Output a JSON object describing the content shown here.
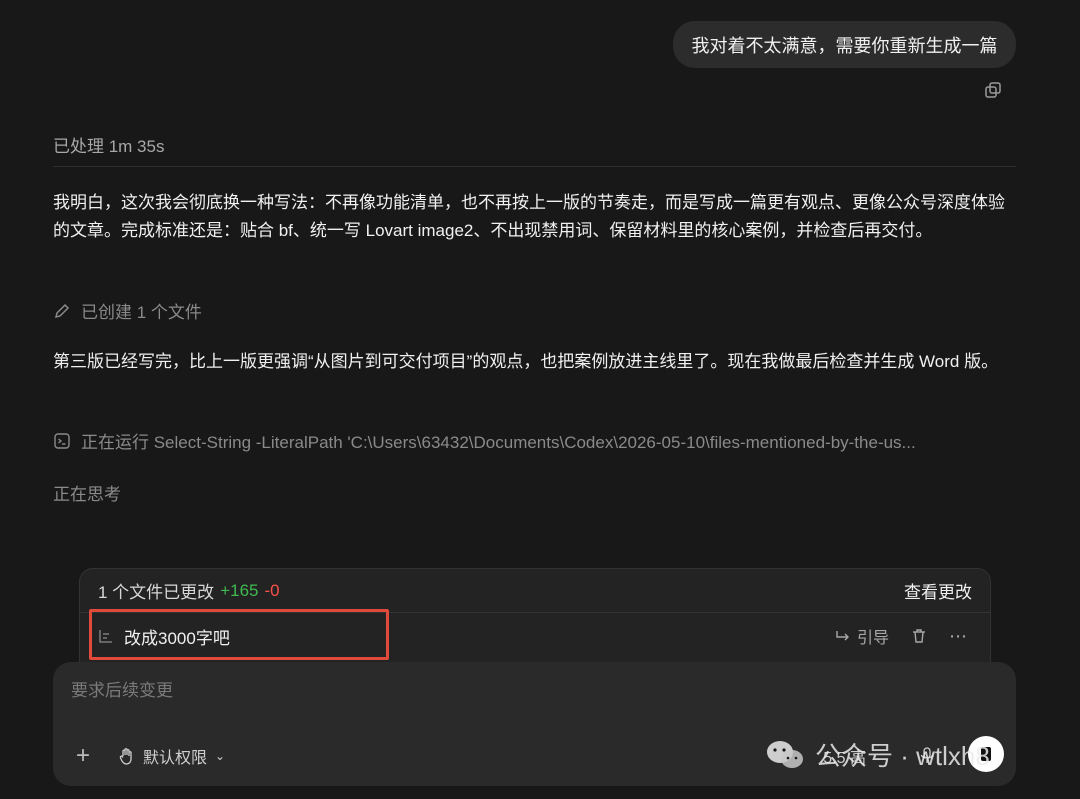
{
  "conversation": {
    "user_message": "我对着不太满意，需要你重新生成一篇",
    "processed_label": "已处理 1m 35s",
    "assistant_para1": "我明白，这次我会彻底换一种写法：不再像功能清单，也不再按上一版的节奏走，而是写成一篇更有观点、更像公众号深度体验的文章。完成标准还是：贴合 bf、统一写 Lovart image2、不出现禁用词、保留材料里的核心案例，并检查后再交付。",
    "created_files_label": "已创建 1 个文件",
    "assistant_para2": "第三版已经写完，比上一版更强调“从图片到可交付项目”的观点，也把案例放进主线里了。现在我做最后检查并生成 Word 版。",
    "running_command": "正在运行 Select-String -LiteralPath 'C:\\Users\\63432\\Documents\\Codex\\2026-05-10\\files-mentioned-by-the-us...",
    "thinking_label": "正在思考"
  },
  "changes_panel": {
    "title": "1 个文件已更改",
    "additions": "+165",
    "deletions": "-0",
    "view_changes_label": "查看更改",
    "queued_message": "改成3000字吧",
    "quote_label": "引导"
  },
  "composer": {
    "placeholder": "要求后续变更",
    "permission_label": "默认权限",
    "model_label": "5.5 高"
  },
  "watermark": {
    "text": "公众号 · wtlxh8"
  },
  "colors": {
    "background": "#181818",
    "additions": "#3fb950",
    "deletions": "#f85149",
    "highlight_border": "#e04a3a"
  }
}
